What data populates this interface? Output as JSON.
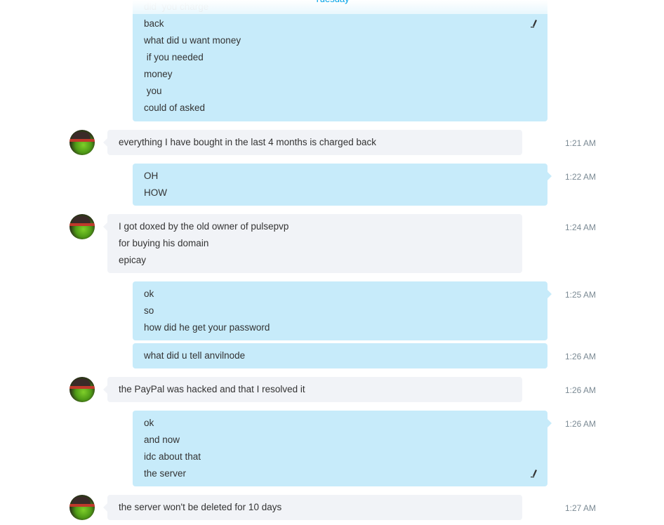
{
  "day_separator": "Tuesday",
  "messages": [
    {
      "lines": [
        "did  you charge",
        "back",
        "what did u want money",
        " if you needed",
        "money",
        " you",
        "could of asked"
      ]
    },
    {
      "lines": [
        "everything I have bought in the last 4 months is charged back"
      ],
      "time": "1:21 AM"
    },
    {
      "lines": [
        "OH",
        "HOW"
      ],
      "time": "1:22 AM"
    },
    {
      "lines": [
        "I got doxed by the old owner of pulsepvp",
        "for buying his domain",
        "epicay"
      ],
      "time": "1:24 AM"
    },
    {
      "lines": [
        "ok",
        "so",
        "how did he get your password"
      ],
      "time": "1:25 AM"
    },
    {
      "lines": [
        "what did u tell anvilnode"
      ],
      "time": "1:26 AM"
    },
    {
      "lines": [
        "the PayPal was hacked and that I resolved it"
      ],
      "time": "1:26 AM"
    },
    {
      "lines": [
        "ok",
        "and now",
        "idc about that",
        "the server"
      ],
      "time": "1:26 AM"
    },
    {
      "lines": [
        "the server won't be deleted for 10 days"
      ],
      "time": "1:27 AM"
    }
  ],
  "icons": {
    "edited": "edit-pencil-icon",
    "avatar": "contact-avatar"
  },
  "colors": {
    "outgoing_bubble": "#c7ebfa",
    "incoming_bubble": "#f1f3f7",
    "accent": "#00a2e6"
  }
}
